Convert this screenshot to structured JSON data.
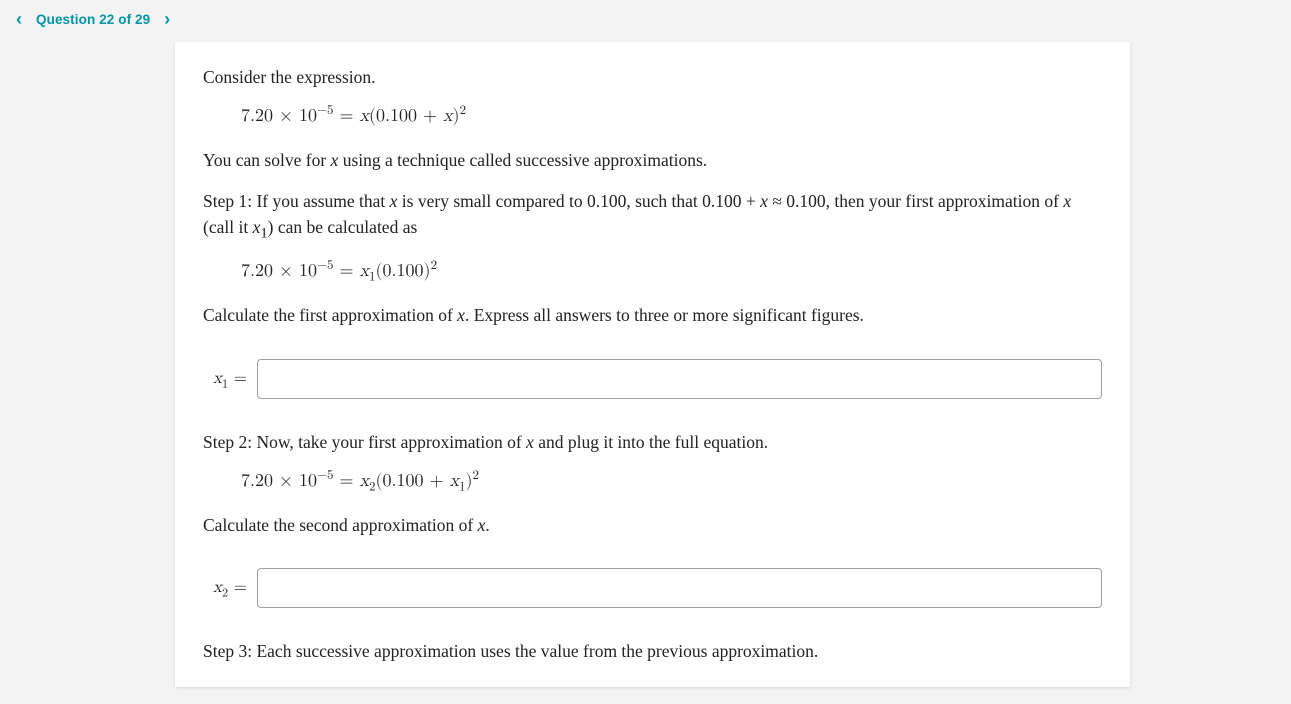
{
  "nav": {
    "prev_glyph": "‹",
    "next_glyph": "›",
    "label": "Question 22 of 29"
  },
  "question": {
    "intro": "Consider the expression.",
    "eq1": {
      "lhs_coeff": "7.20",
      "lhs_exp": "−5",
      "rhs_inside": "0.100"
    },
    "method_line": "You can solve for x using a technique called successive approximations.",
    "step1_text": "Step 1: If you assume that x is very small compared to 0.100, such that 0.100 + x ≈ 0.100, then your first approximation of x (call it x₁) can be calculated as",
    "eq2": {
      "lhs_coeff": "7.20",
      "lhs_exp": "−5",
      "rhs_inside": "0.100"
    },
    "calc1_line": "Calculate the first approximation of x. Express all answers to three or more significant figures.",
    "input1": {
      "value": ""
    },
    "step2_text": "Step 2: Now, take your first approximation of x and plug it into the full equation.",
    "eq3": {
      "lhs_coeff": "7.20",
      "lhs_exp": "−5",
      "rhs_inside": "0.100"
    },
    "calc2_line": "Calculate the second approximation of x.",
    "input2": {
      "value": ""
    },
    "step3_text": "Step 3: Each successive approximation uses the value from the previous approximation."
  }
}
